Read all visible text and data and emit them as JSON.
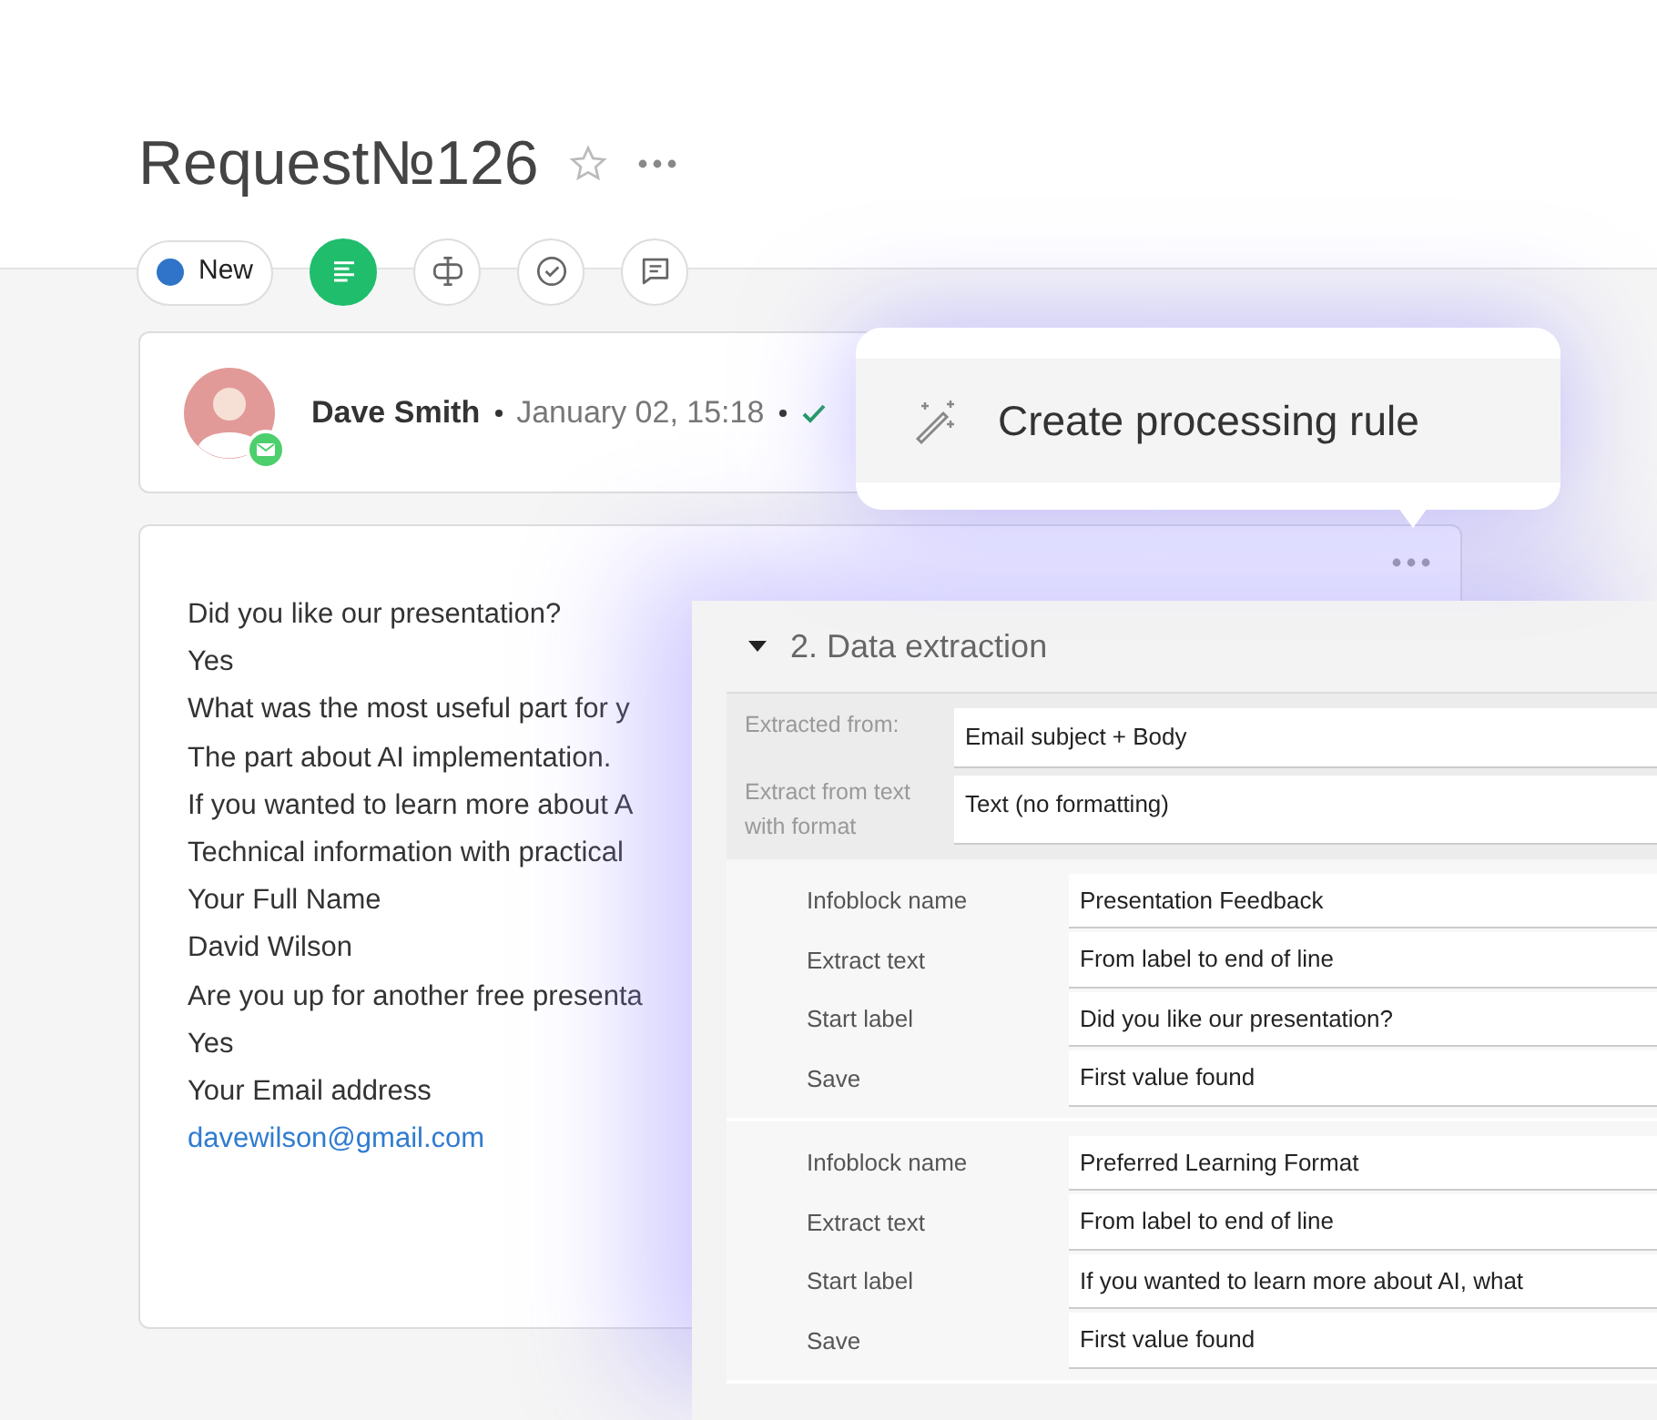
{
  "title": "Request№126",
  "favorite": false,
  "toolbar": {
    "status": {
      "label": "New",
      "color": "#2f74c8"
    },
    "buttons": [
      {
        "kind": "details",
        "selected": true
      },
      {
        "kind": "fields",
        "selected": false
      },
      {
        "kind": "tasks",
        "selected": false
      },
      {
        "kind": "comments",
        "selected": false
      }
    ]
  },
  "message": {
    "sender": "Dave Smith",
    "time": "January 02, 15:18",
    "delivered": true,
    "body": [
      {
        "kind": "text",
        "text": "Did you like our presentation?"
      },
      {
        "kind": "text",
        "text": "Yes"
      },
      {
        "kind": "text",
        "text": "What was the most useful part for y"
      },
      {
        "kind": "text",
        "text": "The part about AI implementation."
      },
      {
        "kind": "text",
        "text": "If you wanted to learn more about A"
      },
      {
        "kind": "text",
        "text": "Technical information with practical"
      },
      {
        "kind": "text",
        "text": "Your Full Name"
      },
      {
        "kind": "text",
        "text": "David Wilson"
      },
      {
        "kind": "text",
        "text": "Are you up for another free presenta"
      },
      {
        "kind": "text",
        "text": "Yes"
      },
      {
        "kind": "text",
        "text": "Your Email address"
      },
      {
        "kind": "link",
        "text": "davewilson@gmail.com"
      }
    ]
  },
  "popup": {
    "label": "Create processing rule"
  },
  "panel": {
    "section": "2. Data extraction",
    "expanded": true,
    "settings": [
      {
        "label": "Extracted from:",
        "value": "Email subject + Body"
      },
      {
        "label": "Extract from text with format",
        "value": "Text (no formatting)"
      }
    ],
    "infoblocks": [
      {
        "fields": [
          {
            "label": "Infoblock name",
            "value": "Presentation Feedback"
          },
          {
            "label": "Extract text",
            "value": "From label to end of line"
          },
          {
            "label": "Start label",
            "value": "Did you like our presentation?"
          },
          {
            "label": "Save",
            "value": "First value found"
          }
        ]
      },
      {
        "fields": [
          {
            "label": "Infoblock name",
            "value": "Preferred Learning Format"
          },
          {
            "label": "Extract text",
            "value": "From label to end of line"
          },
          {
            "label": "Start label",
            "value": "If you wanted to learn more about AI, what"
          },
          {
            "label": "Save",
            "value": "First value found"
          }
        ]
      }
    ]
  }
}
